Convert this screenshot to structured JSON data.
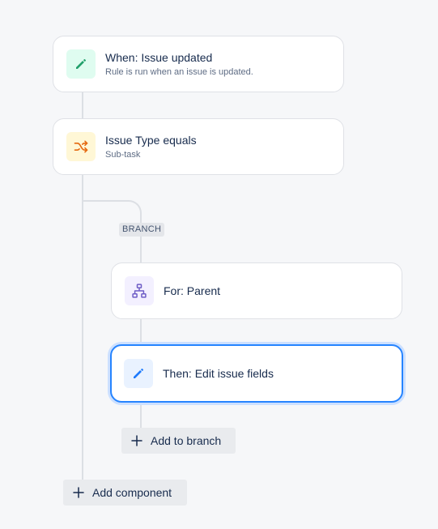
{
  "rule": {
    "trigger": {
      "icon": "pencil-icon",
      "title": "When: Issue updated",
      "subtitle": "Rule is run when an issue is updated."
    },
    "condition": {
      "icon": "shuffle-icon",
      "title": "Issue Type equals",
      "subtitle": "Sub-task"
    },
    "branch": {
      "tag": "BRANCH",
      "for_card": {
        "icon": "hierarchy-icon",
        "title": "For: Parent"
      },
      "action_card": {
        "icon": "pencil-icon",
        "title": "Then: Edit issue fields"
      },
      "add_label": "Add to branch"
    },
    "add_component_label": "Add component"
  },
  "colors": {
    "trigger_icon_bg": "#dffcf0",
    "trigger_icon": "#22a06b",
    "condition_icon_bg": "#fff7d6",
    "condition_icon": "#e56910",
    "branch_icon_bg": "#f3f0ff",
    "branch_icon": "#6e5dc6",
    "action_icon_bg": "#e9f2ff",
    "action_icon": "#1d7afc",
    "selected_border": "#2684ff"
  }
}
